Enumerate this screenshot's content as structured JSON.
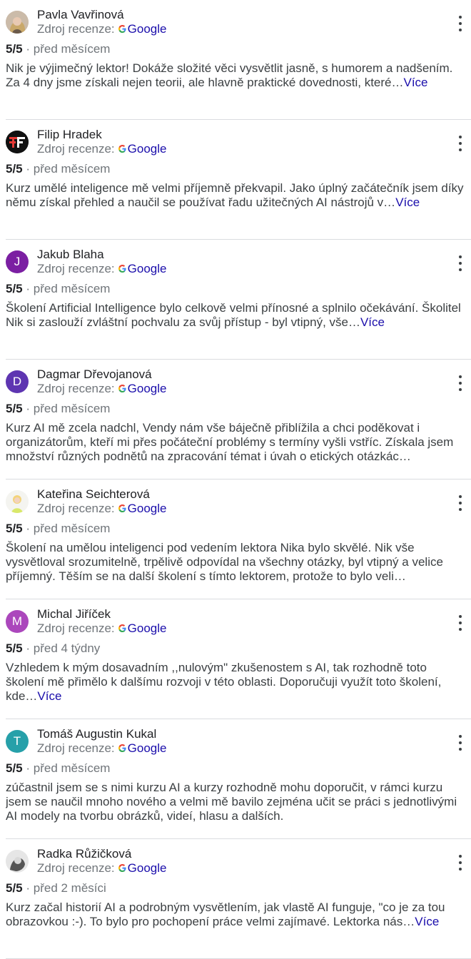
{
  "source_label": "Zdroj recenze:",
  "source_brand": "Google",
  "more_label": "Více",
  "reviews": [
    {
      "author": "Pavla Vavřinová",
      "avatar_type": "photo",
      "score": "5/5",
      "time": "před měsícem",
      "text": "Nik je výjimečný lektor! Dokáže složité věci vysvětlit jasně, s humorem a nadšením. Za 4 dny jsme získali nejen teorii, ale hlavně praktické dovednosti, které…",
      "has_more": true
    },
    {
      "author": "Filip Hradek",
      "avatar_type": "logo",
      "score": "5/5",
      "time": "před měsícem",
      "text": "Kurz umělé inteligence mě velmi příjemně překvapil. Jako úplný začátečník jsem díky němu získal přehled a naučil se používat řadu užitečných AI nástrojů v…",
      "has_more": true
    },
    {
      "author": "Jakub Blaha",
      "avatar_type": "letter",
      "avatar_letter": "J",
      "avatar_color": "#7b1fa2",
      "score": "5/5",
      "time": "před měsícem",
      "text": "Školení Artificial Intelligence bylo celkově velmi přínosné a splnilo očekávání. Školitel Nik si zaslouží zvláštní pochvalu za svůj přístup - byl vtipný, vše…",
      "has_more": true
    },
    {
      "author": "Dagmar Dřevojanová",
      "avatar_type": "letter",
      "avatar_letter": "D",
      "avatar_color": "#5e35b1",
      "score": "5/5",
      "time": "před měsícem",
      "text": "Kurz AI mě zcela nadchl, Vendy nám vše báječně přiblížila a chci poděkovat i organizátorům, kteří mi přes počáteční problémy s termíny vyšli vstříc. Získala jsem množství různých podnětů na zpracování témat i úvah o etických otázkác…",
      "has_more": false
    },
    {
      "author": "Kateřina Seichterová",
      "avatar_type": "photo2",
      "score": "5/5",
      "time": "před měsícem",
      "text": "Školení na umělou inteligenci pod vedením lektora Nika bylo skvělé. Nik vše vysvětloval srozumitelně, trpělivě odpovídal na všechny otázky, byl vtipný a velice příjemný. Těším se na další školení s tímto lektorem, protože to bylo veli…",
      "has_more": false
    },
    {
      "author": "Michal Jiříček",
      "avatar_type": "letter",
      "avatar_letter": "M",
      "avatar_color": "#ab47bc",
      "score": "5/5",
      "time": "před 4 týdny",
      "text": "Vzhledem k mým dosavadním ,,nulovým\" zkušenostem s AI, tak rozhodně toto školení mě přimělo k dalšímu rozvoji v této oblasti. Doporučuji využít toto školení, kde…",
      "has_more": true
    },
    {
      "author": "Tomáš Augustin Kukal",
      "avatar_type": "letter",
      "avatar_letter": "T",
      "avatar_color": "#26a0a9",
      "score": "5/5",
      "time": "před měsícem",
      "text": "zúčastnil jsem se s nimi kurzu AI a kurzy rozhodně mohu doporučit, v rámci kurzu jsem se naučil mnoho nového a velmi mě bavilo zejména učit se práci s jednotlivými AI modely na tvorbu obrázků, videí, hlasu a dalších.",
      "has_more": false
    },
    {
      "author": "Radka Růžičková",
      "avatar_type": "photo3",
      "score": "5/5",
      "time": "před 2 měsíci",
      "text": "Kurz začal historií AI a podrobným vysvětlením, jak vlastě AI funguje, \"co je za tou obrazovkou :-). To bylo pro pochopení práce velmi zajímavé. Lektorka nás…",
      "has_more": true
    }
  ]
}
